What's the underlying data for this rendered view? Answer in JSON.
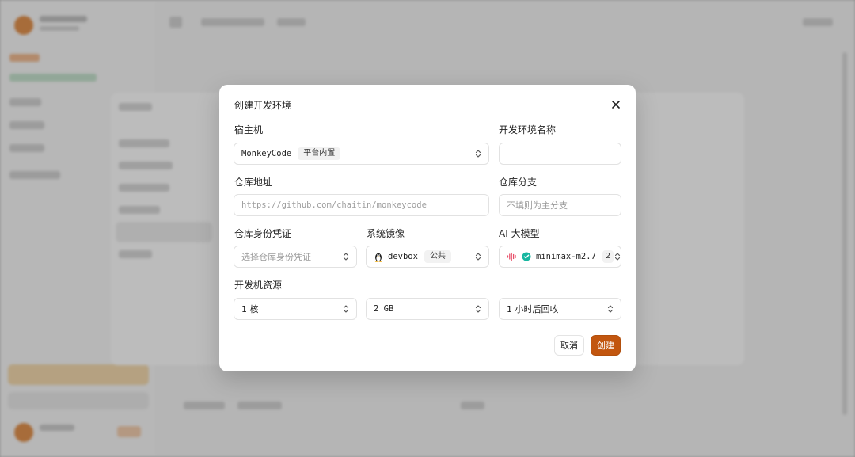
{
  "dialog": {
    "title": "创建开发环境",
    "close_icon": "close-icon"
  },
  "form": {
    "host": {
      "label": "宿主机",
      "value": "MonkeyCode",
      "tag": "平台内置"
    },
    "env_name": {
      "label": "开发环境名称",
      "value": "",
      "placeholder": ""
    },
    "repo_url": {
      "label": "仓库地址",
      "placeholder": "https://github.com/chaitin/monkeycode"
    },
    "repo_branch": {
      "label": "仓库分支",
      "placeholder": "不填则为主分支"
    },
    "repo_credential": {
      "label": "仓库身份凭证",
      "placeholder": "选择仓库身份凭证"
    },
    "system_image": {
      "label": "系统镜像",
      "value": "devbox",
      "tag": "公共",
      "icon": "linux-penguin-icon"
    },
    "ai_model": {
      "label": "AI 大模型",
      "value": "minimax-m2.7",
      "tag_partial": "2",
      "icon": "minimax-logo-icon",
      "verified_icon": "verified-check-icon"
    },
    "resources": {
      "label": "开发机资源",
      "cpu": "1 核",
      "memory": "2 GB",
      "recycle": "1 小时后回收"
    }
  },
  "buttons": {
    "cancel": "取消",
    "create": "创建"
  },
  "colors": {
    "primary": "#c2560f",
    "verified": "#17b6a0"
  }
}
